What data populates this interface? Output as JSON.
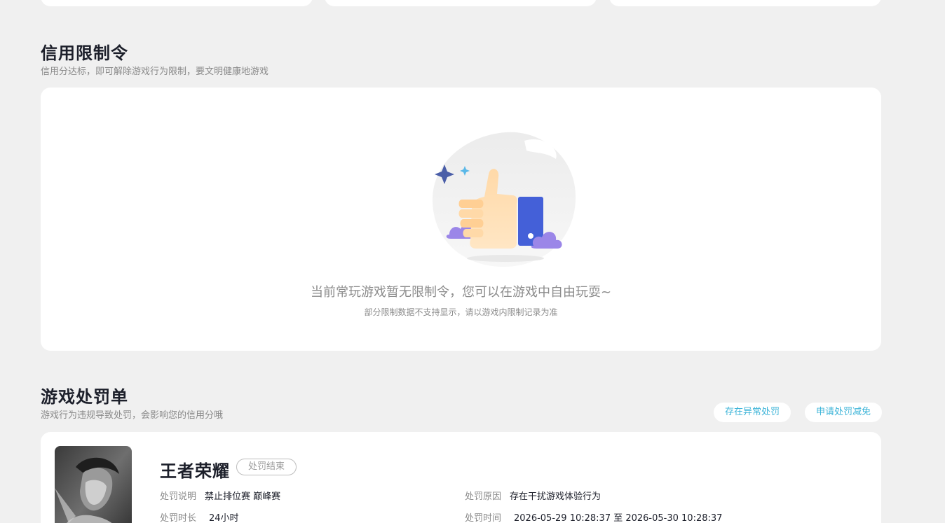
{
  "credit_restriction": {
    "title": "信用限制令",
    "subtitle": "信用分达标，即可解除游戏行为限制，要文明健康地游戏",
    "empty_main": "当前常玩游戏暂无限制令，您可以在游戏中自由玩耍~",
    "empty_sub": "部分限制数据不支持显示，请以游戏内限制记录为准"
  },
  "penalty": {
    "title": "游戏处罚单",
    "subtitle": "游戏行为违规导致处罚，会影响您的信用分哦",
    "abnormal_button": "存在异常处罚",
    "reduce_button": "申请处罚减免",
    "record": {
      "game_name": "王者荣耀",
      "status": "处罚结束",
      "desc_label": "处罚说明",
      "desc_value": "禁止排位赛 巅峰赛",
      "duration_label": "处罚时长",
      "duration_value": "24小时",
      "reason_label": "处罚原因",
      "reason_value": "存在干扰游戏体验行为",
      "time_label": "处罚时间",
      "time_value": "2026-05-29 10:28:37 至 2026-05-30 10:28:37"
    }
  },
  "colors": {
    "accent": "#3cb4d8",
    "background": "#f0f0f0",
    "card": "#ffffff",
    "title": "#1c1f2a"
  },
  "icons": [
    "thumbs-up-illustration-icon",
    "sparkle-icon",
    "cloud-icon"
  ]
}
